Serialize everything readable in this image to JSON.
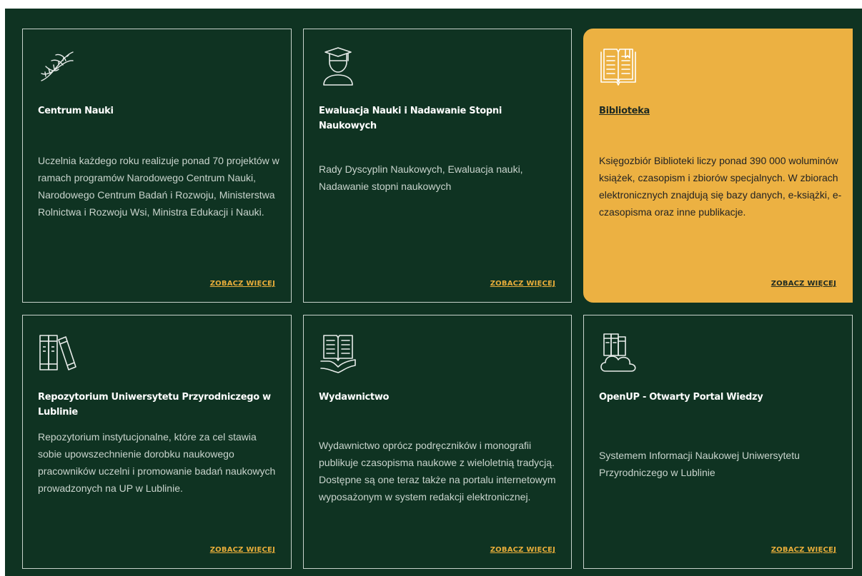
{
  "more_label": "ZOBACZ WIĘCEJ",
  "colors": {
    "panel": "#0f3322",
    "accent": "#ecb142",
    "border": "#c8d3cc"
  },
  "cards": [
    {
      "icon": "dna-icon",
      "title": "Centrum Nauki",
      "desc": "Uczelnia każdego roku realizuje ponad 70 projektów w ramach programów Narodowego Centrum Nauki, Narodowego Centrum Badań i Rozwoju, Ministerstwa Rolnictwa i Rozwoju Wsi, Ministra Edukacji i Nauki."
    },
    {
      "icon": "graduate-icon",
      "title": "Ewaluacja Nauki i Nadawanie Stopni Naukowych",
      "desc": "Rady Dyscyplin Naukowych, Ewaluacja nauki, Nadawanie stopni naukowych"
    },
    {
      "icon": "open-book-icon",
      "title": "Biblioteka",
      "desc": "Księgozbiór Biblioteki liczy ponad 390 000 woluminów książek, czasopism i zbiorów specjalnych. W zbiorach elektronicznych znajdują się bazy danych, e-książki, e-czasopisma oraz inne publikacje."
    },
    {
      "icon": "books-icon",
      "title": "Repozytorium Uniwersytetu Przyrodniczego w Lublinie",
      "desc": "Repozytorium instytucjonalne, które za cel stawia sobie upowszechnienie dorobku naukowego pracowników uczelni i promowanie badań naukowych prowadzonych na UP w Lublinie."
    },
    {
      "icon": "book-hand-icon",
      "title": "Wydawnictwo",
      "desc": "Wydawnictwo oprócz podręczników i monografii publikuje czasopisma naukowe z wieloletnią tradycją. Dostępne są one teraz także na portalu internetowym wyposażonym w system redakcji elektronicznej."
    },
    {
      "icon": "books-cloud-icon",
      "title": "OpenUP - Otwarty Portal Wiedzy",
      "desc": "Systemem Informacji Naukowej Uniwersytetu Przyrodniczego w Lublinie"
    }
  ]
}
